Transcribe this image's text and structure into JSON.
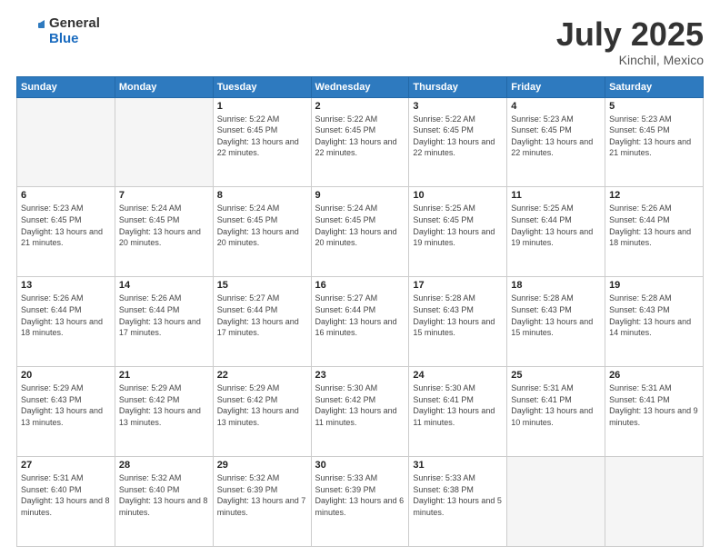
{
  "header": {
    "logo_general": "General",
    "logo_blue": "Blue",
    "title": "July 2025",
    "location": "Kinchil, Mexico"
  },
  "days_of_week": [
    "Sunday",
    "Monday",
    "Tuesday",
    "Wednesday",
    "Thursday",
    "Friday",
    "Saturday"
  ],
  "weeks": [
    [
      {
        "num": "",
        "empty": true
      },
      {
        "num": "",
        "empty": true
      },
      {
        "num": "1",
        "sunrise": "5:22 AM",
        "sunset": "6:45 PM",
        "daylight": "13 hours and 22 minutes."
      },
      {
        "num": "2",
        "sunrise": "5:22 AM",
        "sunset": "6:45 PM",
        "daylight": "13 hours and 22 minutes."
      },
      {
        "num": "3",
        "sunrise": "5:22 AM",
        "sunset": "6:45 PM",
        "daylight": "13 hours and 22 minutes."
      },
      {
        "num": "4",
        "sunrise": "5:23 AM",
        "sunset": "6:45 PM",
        "daylight": "13 hours and 22 minutes."
      },
      {
        "num": "5",
        "sunrise": "5:23 AM",
        "sunset": "6:45 PM",
        "daylight": "13 hours and 21 minutes."
      }
    ],
    [
      {
        "num": "6",
        "sunrise": "5:23 AM",
        "sunset": "6:45 PM",
        "daylight": "13 hours and 21 minutes."
      },
      {
        "num": "7",
        "sunrise": "5:24 AM",
        "sunset": "6:45 PM",
        "daylight": "13 hours and 20 minutes."
      },
      {
        "num": "8",
        "sunrise": "5:24 AM",
        "sunset": "6:45 PM",
        "daylight": "13 hours and 20 minutes."
      },
      {
        "num": "9",
        "sunrise": "5:24 AM",
        "sunset": "6:45 PM",
        "daylight": "13 hours and 20 minutes."
      },
      {
        "num": "10",
        "sunrise": "5:25 AM",
        "sunset": "6:45 PM",
        "daylight": "13 hours and 19 minutes."
      },
      {
        "num": "11",
        "sunrise": "5:25 AM",
        "sunset": "6:44 PM",
        "daylight": "13 hours and 19 minutes."
      },
      {
        "num": "12",
        "sunrise": "5:26 AM",
        "sunset": "6:44 PM",
        "daylight": "13 hours and 18 minutes."
      }
    ],
    [
      {
        "num": "13",
        "sunrise": "5:26 AM",
        "sunset": "6:44 PM",
        "daylight": "13 hours and 18 minutes."
      },
      {
        "num": "14",
        "sunrise": "5:26 AM",
        "sunset": "6:44 PM",
        "daylight": "13 hours and 17 minutes."
      },
      {
        "num": "15",
        "sunrise": "5:27 AM",
        "sunset": "6:44 PM",
        "daylight": "13 hours and 17 minutes."
      },
      {
        "num": "16",
        "sunrise": "5:27 AM",
        "sunset": "6:44 PM",
        "daylight": "13 hours and 16 minutes."
      },
      {
        "num": "17",
        "sunrise": "5:28 AM",
        "sunset": "6:43 PM",
        "daylight": "13 hours and 15 minutes."
      },
      {
        "num": "18",
        "sunrise": "5:28 AM",
        "sunset": "6:43 PM",
        "daylight": "13 hours and 15 minutes."
      },
      {
        "num": "19",
        "sunrise": "5:28 AM",
        "sunset": "6:43 PM",
        "daylight": "13 hours and 14 minutes."
      }
    ],
    [
      {
        "num": "20",
        "sunrise": "5:29 AM",
        "sunset": "6:43 PM",
        "daylight": "13 hours and 13 minutes."
      },
      {
        "num": "21",
        "sunrise": "5:29 AM",
        "sunset": "6:42 PM",
        "daylight": "13 hours and 13 minutes."
      },
      {
        "num": "22",
        "sunrise": "5:29 AM",
        "sunset": "6:42 PM",
        "daylight": "13 hours and 13 minutes."
      },
      {
        "num": "23",
        "sunrise": "5:30 AM",
        "sunset": "6:42 PM",
        "daylight": "13 hours and 11 minutes."
      },
      {
        "num": "24",
        "sunrise": "5:30 AM",
        "sunset": "6:41 PM",
        "daylight": "13 hours and 11 minutes."
      },
      {
        "num": "25",
        "sunrise": "5:31 AM",
        "sunset": "6:41 PM",
        "daylight": "13 hours and 10 minutes."
      },
      {
        "num": "26",
        "sunrise": "5:31 AM",
        "sunset": "6:41 PM",
        "daylight": "13 hours and 9 minutes."
      }
    ],
    [
      {
        "num": "27",
        "sunrise": "5:31 AM",
        "sunset": "6:40 PM",
        "daylight": "13 hours and 8 minutes."
      },
      {
        "num": "28",
        "sunrise": "5:32 AM",
        "sunset": "6:40 PM",
        "daylight": "13 hours and 8 minutes."
      },
      {
        "num": "29",
        "sunrise": "5:32 AM",
        "sunset": "6:39 PM",
        "daylight": "13 hours and 7 minutes."
      },
      {
        "num": "30",
        "sunrise": "5:33 AM",
        "sunset": "6:39 PM",
        "daylight": "13 hours and 6 minutes."
      },
      {
        "num": "31",
        "sunrise": "5:33 AM",
        "sunset": "6:38 PM",
        "daylight": "13 hours and 5 minutes."
      },
      {
        "num": "",
        "empty": true
      },
      {
        "num": "",
        "empty": true
      }
    ]
  ]
}
